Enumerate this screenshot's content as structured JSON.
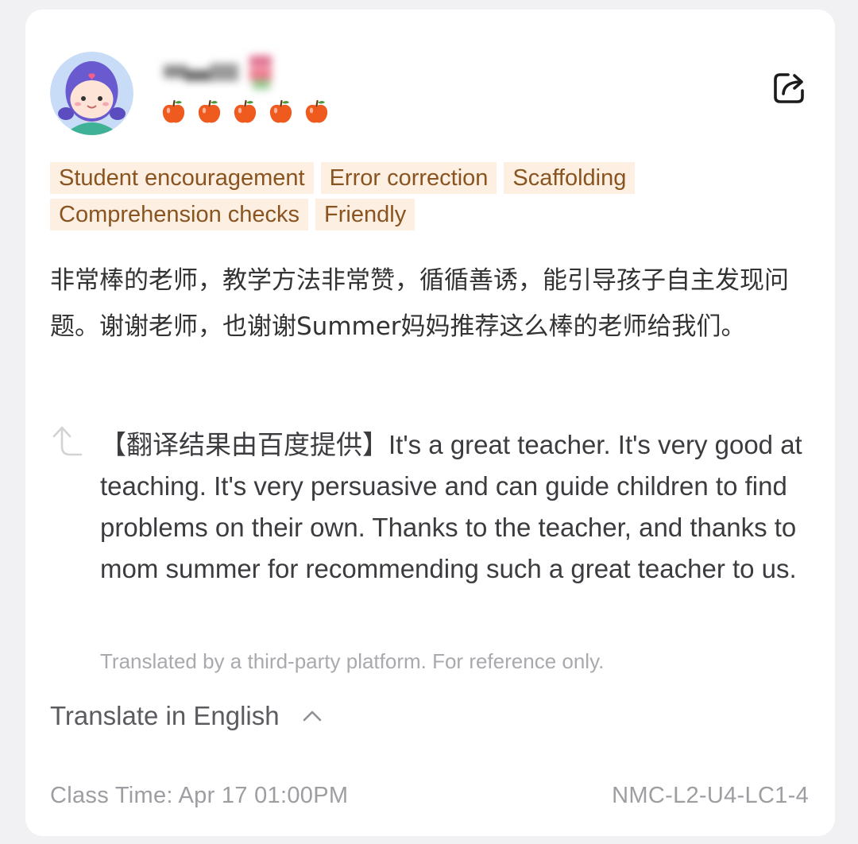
{
  "tags": [
    "Student encouragement",
    "Error correction",
    "Scaffolding",
    "Comprehension checks",
    "Friendly"
  ],
  "review": {
    "text": "非常棒的老师，教学方法非常赞，循循善诱，能引导孩子自主发现问题。谢谢老师，也谢谢Summer妈妈推荐这么棒的老师给我们。",
    "translation": "【翻译结果由百度提供】It's a great teacher. It's very good at teaching. It's very persuasive and can guide children to find problems on their own. Thanks to the teacher, and thanks to mom summer for recommending such a great teacher to us.",
    "disclaimer": "Translated by a third-party platform. For reference only."
  },
  "translate_toggle": {
    "label": "Translate in English",
    "icon": "chevron-up-icon"
  },
  "footer": {
    "class_time": "Class Time: Apr 17 01:00PM",
    "class_code": "NMC-L2-U4-LC1-4"
  },
  "rating": {
    "apples": 5,
    "max": 5
  },
  "icons": {
    "share": "share-icon",
    "translate": "translate-arrow-icon"
  },
  "colors": {
    "tag_bg": "#fdf0e3",
    "tag_text": "#8a5420",
    "apple": "#ef5a1f"
  }
}
